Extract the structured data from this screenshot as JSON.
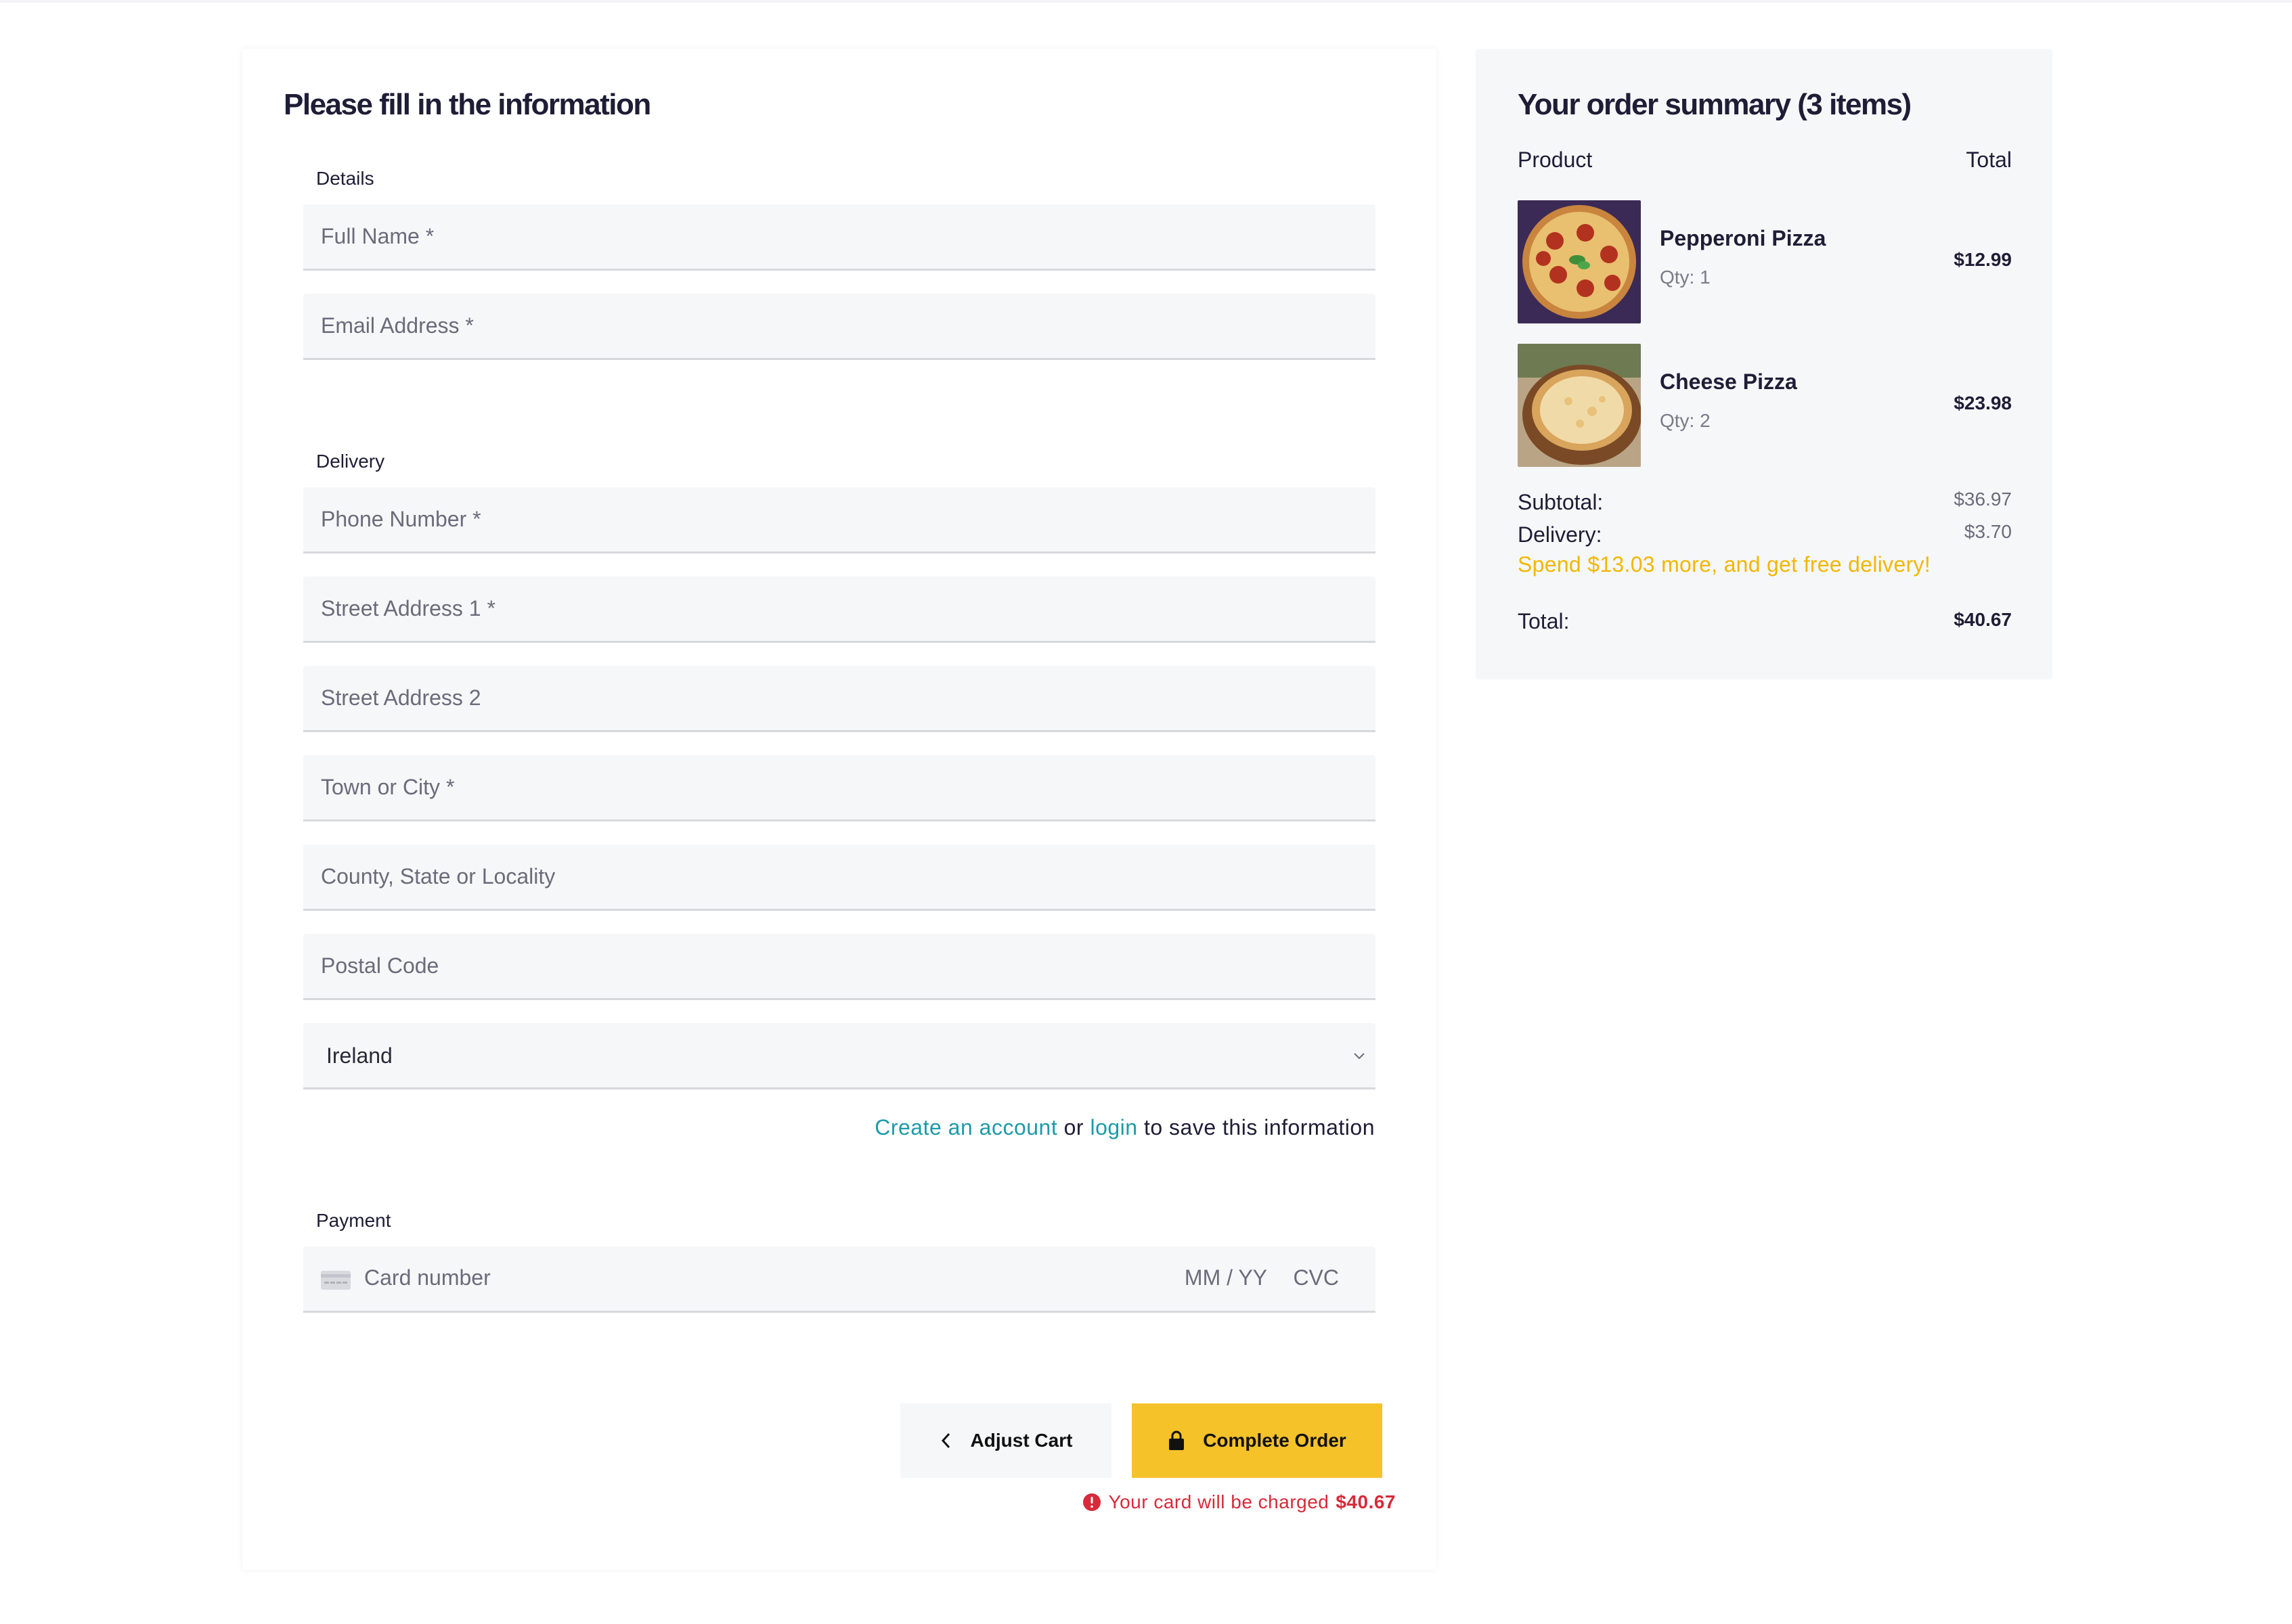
{
  "form": {
    "title": "Please fill in the information",
    "details_label": "Details",
    "full_name_placeholder": "Full Name *",
    "email_placeholder": "Email Address *",
    "delivery_label": "Delivery",
    "phone_placeholder": "Phone Number *",
    "street1_placeholder": "Street Address 1 *",
    "street2_placeholder": "Street Address 2",
    "town_placeholder": "Town or City *",
    "county_placeholder": "County, State or Locality",
    "postal_placeholder": "Postal Code",
    "country_value": "Ireland",
    "account_prompt": {
      "create_link": "Create an account",
      "or_text": "or",
      "login_link": "login",
      "suffix": "to save this information"
    },
    "payment_label": "Payment",
    "card": {
      "number_placeholder": "Card number",
      "exp_placeholder": "MM / YY",
      "cvc_placeholder": "CVC",
      "icon": "credit-card-icon"
    },
    "buttons": {
      "adjust_cart": "Adjust Cart",
      "complete_order": "Complete Order"
    },
    "charge_note": {
      "text": "Your card will be charged",
      "amount": "$40.67",
      "icon": "error-circle-icon"
    }
  },
  "summary": {
    "title": "Your order summary (3 items)",
    "col_product": "Product",
    "col_total": "Total",
    "items": [
      {
        "name": "Pepperoni Pizza",
        "qty": "Qty: 1",
        "price": "$12.99"
      },
      {
        "name": "Cheese Pizza",
        "qty": "Qty: 2",
        "price": "$23.98"
      }
    ],
    "subtotal_label": "Subtotal:",
    "subtotal_value": "$36.97",
    "delivery_label": "Delivery:",
    "delivery_value": "$3.70",
    "promo": "Spend $13.03 more, and get free delivery!",
    "total_label": "Total:",
    "total_value": "$40.67"
  },
  "colors": {
    "accent_yellow": "#f5c22a",
    "promo_yellow": "#f2b705",
    "link_teal": "#1e9aa8",
    "error_red": "#d72a3a",
    "text_dark": "#1f1d36",
    "field_bg": "#f6f7f8"
  }
}
